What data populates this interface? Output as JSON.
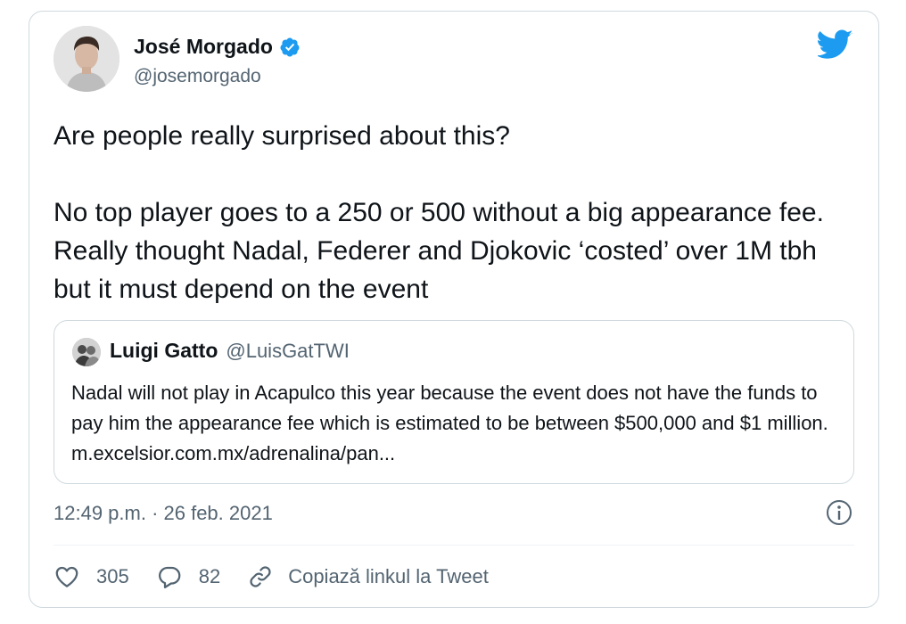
{
  "tweet": {
    "author": {
      "name": "José Morgado",
      "handle": "@josemorgado",
      "verified": true,
      "avatar_icon": "avatar-photo"
    },
    "brand_icon": "twitter-bird-icon",
    "text": "Are people really surprised about this?\n\nNo top player goes to a 250 or 500 without a big appearance fee. Really thought Nadal, Federer and Djokovic ‘costed’ over 1M tbh but it must depend on the event",
    "quoted": {
      "name": "Luigi Gatto",
      "handle": "@LuisGatTWI",
      "text": "Nadal will not play in Acapulco this year because the event does not have the funds to pay him the appearance fee which is estimated to be between $500,000 and $1 million. m.excelsior.com.mx/adrenalina/pan..."
    },
    "timestamp": "12:49 p.m. · 26 feb. 2021",
    "actions": {
      "likes": "305",
      "replies": "82",
      "copy_link": "Copiază linkul la Tweet"
    }
  },
  "colors": {
    "accent": "#1d9bf0",
    "text_primary": "#0f1419",
    "text_secondary": "#536471",
    "border": "#cfd9de"
  }
}
